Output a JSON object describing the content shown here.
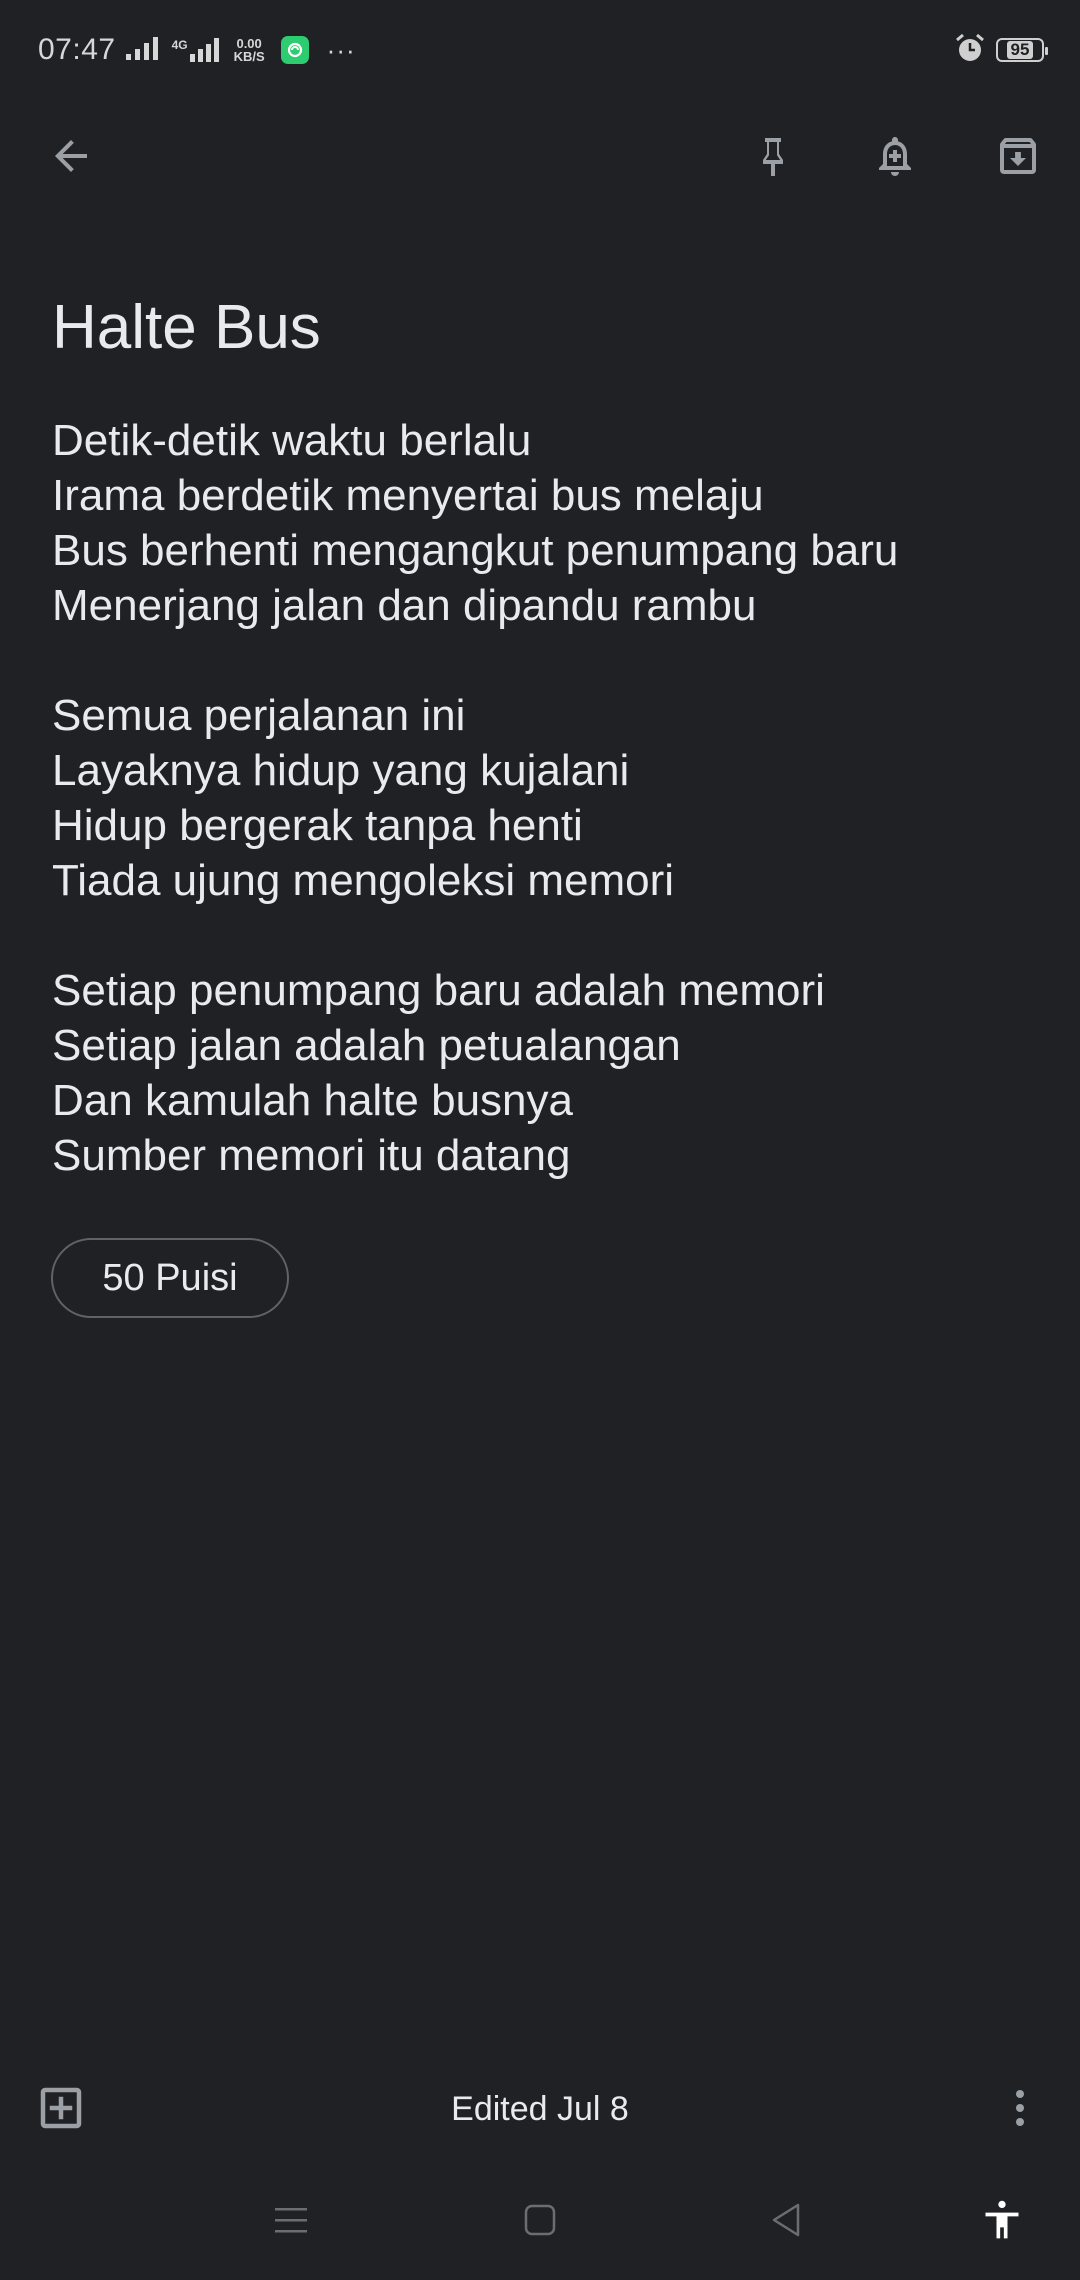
{
  "status_bar": {
    "time": "07:47",
    "network_type": "4G",
    "net_speed_value": "0.00",
    "net_speed_unit": "KB/S",
    "more_indicator": "···",
    "battery_level": "95",
    "icons": [
      "signal-bars-icon",
      "signal-bars-4g-icon",
      "app-notification-icon",
      "alarm-icon",
      "battery-icon"
    ]
  },
  "top_bar": {
    "icons": [
      "back-arrow-icon",
      "pin-icon",
      "reminder-bell-icon",
      "archive-icon"
    ]
  },
  "note": {
    "title": "Halte Bus",
    "stanzas": [
      [
        "Detik-detik waktu berlalu",
        "Irama berdetik menyertai bus melaju",
        "Bus berhenti mengangkut penumpang baru",
        "Menerjang jalan dan dipandu rambu"
      ],
      [
        "Semua perjalanan ini",
        "Layaknya hidup yang kujalani",
        "Hidup bergerak tanpa henti",
        "Tiada ujung mengoleksi memori"
      ],
      [
        "Setiap penumpang baru adalah memori",
        "Setiap jalan adalah petualangan",
        "Dan kamulah halte busnya",
        "Sumber memori itu datang"
      ]
    ],
    "label": "50 Puisi"
  },
  "bottom_bar": {
    "edited_text": "Edited Jul 8",
    "icons": [
      "add-box-icon",
      "more-vert-icon"
    ]
  },
  "nav_bar": {
    "icons": [
      "menu-lines-icon",
      "home-square-icon",
      "back-triangle-icon",
      "accessibility-icon"
    ]
  },
  "colors": {
    "background": "#202124",
    "text": "#e8eaed",
    "icon": "#9aa0a6",
    "chip_border": "#5f6368",
    "app_badge": "#2ecc71"
  }
}
